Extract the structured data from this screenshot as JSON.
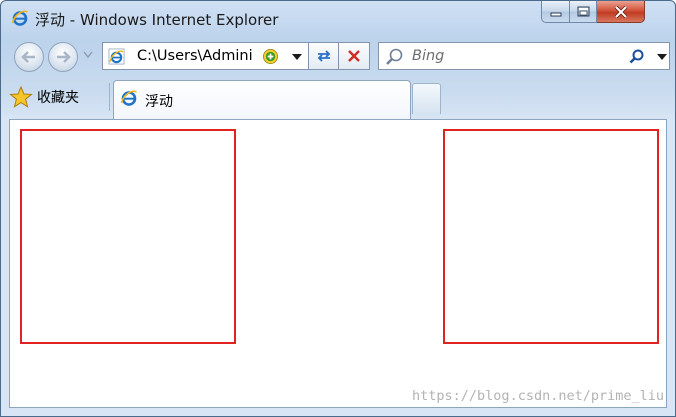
{
  "window": {
    "title": "浮动 - Windows Internet Explorer",
    "icon": "ie-icon"
  },
  "caption_buttons": {
    "minimize_icon": "minimize-icon",
    "maximize_icon": "maximize-icon",
    "close_icon": "close-icon",
    "close_color": "#c8432b"
  },
  "navigation": {
    "back_icon": "back-arrow-icon",
    "forward_icon": "forward-arrow-icon",
    "address": "C:\\Users\\Admini",
    "refresh_icon": "refresh-icon",
    "stop_icon": "stop-icon"
  },
  "search": {
    "placeholder": "Bing"
  },
  "tabs": {
    "favorites_label": "收藏夹",
    "favorites_icon": "star-icon",
    "items": [
      {
        "label": "浮动",
        "icon": "ie-icon",
        "active": true
      }
    ]
  },
  "content": {
    "boxes": [
      {
        "name": "left-float-box",
        "border_color": "#e02222"
      },
      {
        "name": "right-float-box",
        "border_color": "#e02222"
      }
    ],
    "watermark": "https://blog.csdn.net/prime_liu"
  }
}
